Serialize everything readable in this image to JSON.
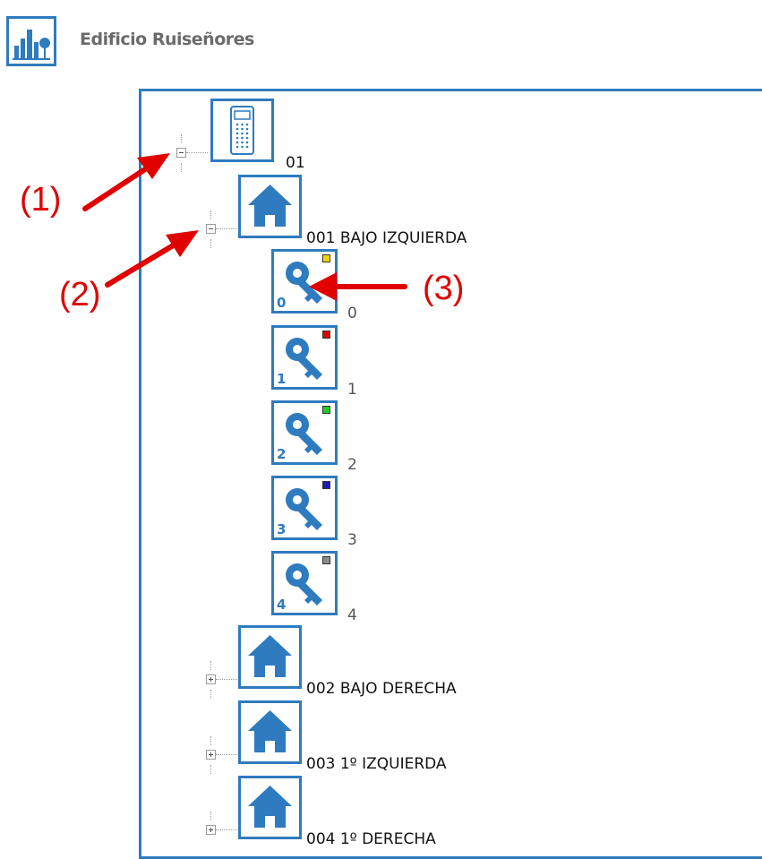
{
  "header": {
    "title": "Edificio Ruiseñores",
    "icon": "building-chart-icon"
  },
  "tree": {
    "root": {
      "label": "01",
      "icon": "intercom-panel-icon",
      "expanded": true
    },
    "units": [
      {
        "label": "001 BAJO IZQUIERDA",
        "icon": "house-icon",
        "expanded": true
      },
      {
        "label": "002 BAJO DERECHA",
        "icon": "house-icon",
        "expanded": false
      },
      {
        "label": "003 1º IZQUIERDA",
        "icon": "house-icon",
        "expanded": false
      },
      {
        "label": "004 1º DERECHA",
        "icon": "house-icon",
        "expanded": false
      }
    ],
    "keys": [
      {
        "label": "0",
        "number": "0",
        "color": "#f2d400"
      },
      {
        "label": "1",
        "number": "1",
        "color": "#e00000"
      },
      {
        "label": "2",
        "number": "2",
        "color": "#22cc22"
      },
      {
        "label": "3",
        "number": "3",
        "color": "#1c1cb4"
      },
      {
        "label": "4",
        "number": "4",
        "color": "#8c8c8c"
      }
    ]
  },
  "callouts": [
    "(1)",
    "(2)",
    "(3)"
  ],
  "colors": {
    "accent": "#2f7bbf",
    "annotation": "#e00000"
  }
}
